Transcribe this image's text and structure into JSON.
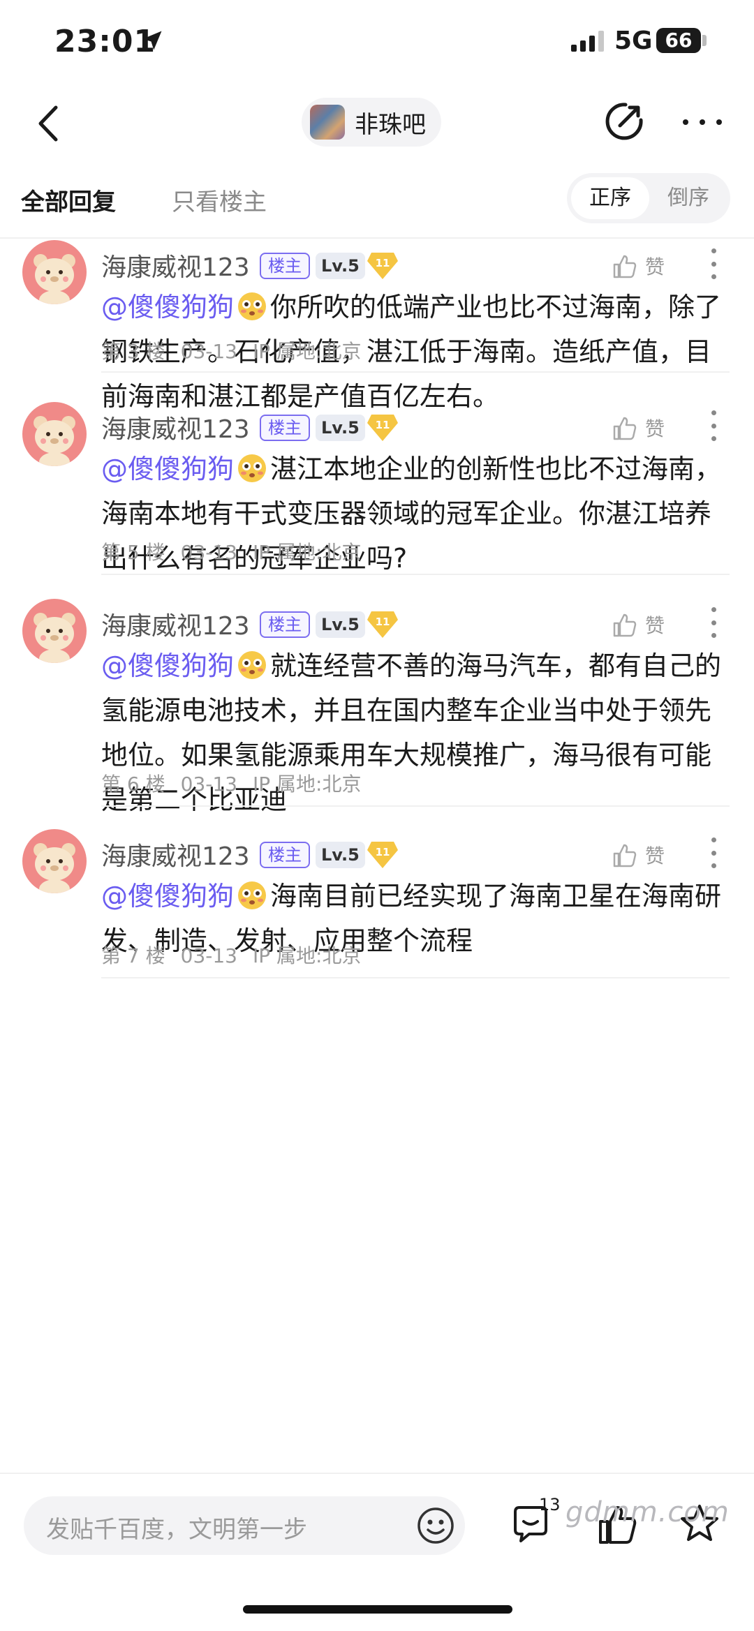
{
  "status_bar": {
    "time": "23:01",
    "network": "5G",
    "battery": "66"
  },
  "nav": {
    "forum_name": "非珠吧"
  },
  "tabs": {
    "all_replies": "全部回复",
    "only_op": "只看楼主",
    "order_asc": "正序",
    "order_desc": "倒序"
  },
  "posts": [
    {
      "author": "海康威视123",
      "op_badge": "楼主",
      "level": "Lv.5",
      "gem_level": "11",
      "like_label": "赞",
      "mention": "@傻傻狗狗",
      "text": "你所吹的低端产业也比不过海南，除了钢铁生产。石化产值，湛江低于海南。造纸产值，目前海南和湛江都是产值百亿左右。",
      "floor": "第 3 楼",
      "date": "03-13",
      "ip": "IP 属地:北京"
    },
    {
      "author": "海康威视123",
      "op_badge": "楼主",
      "level": "Lv.5",
      "gem_level": "11",
      "like_label": "赞",
      "mention": "@傻傻狗狗",
      "text": "湛江本地企业的创新性也比不过海南，海南本地有干式变压器领域的冠军企业。你湛江培养出什么有名的冠军企业吗?",
      "floor": "第 5 楼",
      "date": "03-13",
      "ip": "IP 属地:北京"
    },
    {
      "author": "海康威视123",
      "op_badge": "楼主",
      "level": "Lv.5",
      "gem_level": "11",
      "like_label": "赞",
      "mention": "@傻傻狗狗",
      "text": "就连经营不善的海马汽车，都有自己的氢能源电池技术，并且在国内整车企业当中处于领先地位。如果氢能源乘用车大规模推广，海马很有可能是第二个比亚迪",
      "floor": "第 6 楼",
      "date": "03-13",
      "ip": "IP 属地:北京"
    },
    {
      "author": "海康威视123",
      "op_badge": "楼主",
      "level": "Lv.5",
      "gem_level": "11",
      "like_label": "赞",
      "mention": "@傻傻狗狗",
      "text": "海南目前已经实现了海南卫星在海南研发、制造、发射、应用整个流程",
      "floor": "第 7 楼",
      "date": "03-13",
      "ip": "IP 属地:北京"
    }
  ],
  "bottom_bar": {
    "reply_placeholder": "发贴千百度，文明第一步",
    "comment_count": "13"
  },
  "watermark": "gdmm.com"
}
